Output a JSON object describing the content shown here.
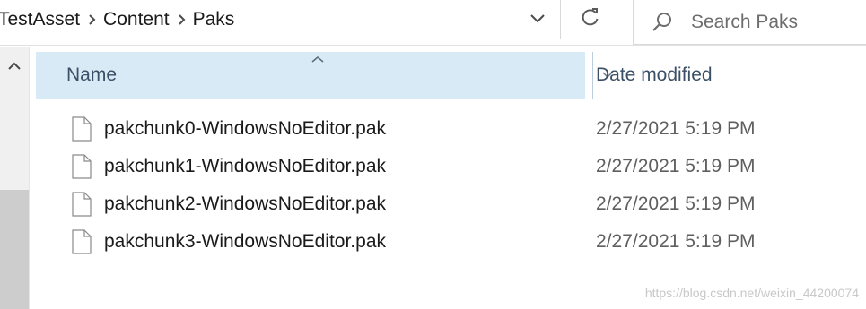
{
  "breadcrumb": {
    "items": [
      "TestAsset",
      "Content",
      "Paks"
    ]
  },
  "search": {
    "placeholder": "Search Paks"
  },
  "columns": {
    "name": "Name",
    "date_modified": "Date modified"
  },
  "files": [
    {
      "name": "pakchunk0-WindowsNoEditor.pak",
      "date": "2/27/2021 5:19 PM"
    },
    {
      "name": "pakchunk1-WindowsNoEditor.pak",
      "date": "2/27/2021 5:19 PM"
    },
    {
      "name": "pakchunk2-WindowsNoEditor.pak",
      "date": "2/27/2021 5:19 PM"
    },
    {
      "name": "pakchunk3-WindowsNoEditor.pak",
      "date": "2/27/2021 5:19 PM"
    }
  ],
  "watermark": "https://blog.csdn.net/weixin_44200074",
  "icons": {
    "breadcrumb_separator": "chevron-right-icon",
    "address_dropdown": "chevron-down-icon",
    "refresh": "refresh-icon",
    "search": "search-icon",
    "scroll_up": "chevron-up-icon",
    "sort": "sort-ascending-icon",
    "column_menu": "chevron-down-icon",
    "file": "file-icon"
  },
  "colors": {
    "header_highlight": "#d9eaf7",
    "header_text": "#3b4f66"
  }
}
